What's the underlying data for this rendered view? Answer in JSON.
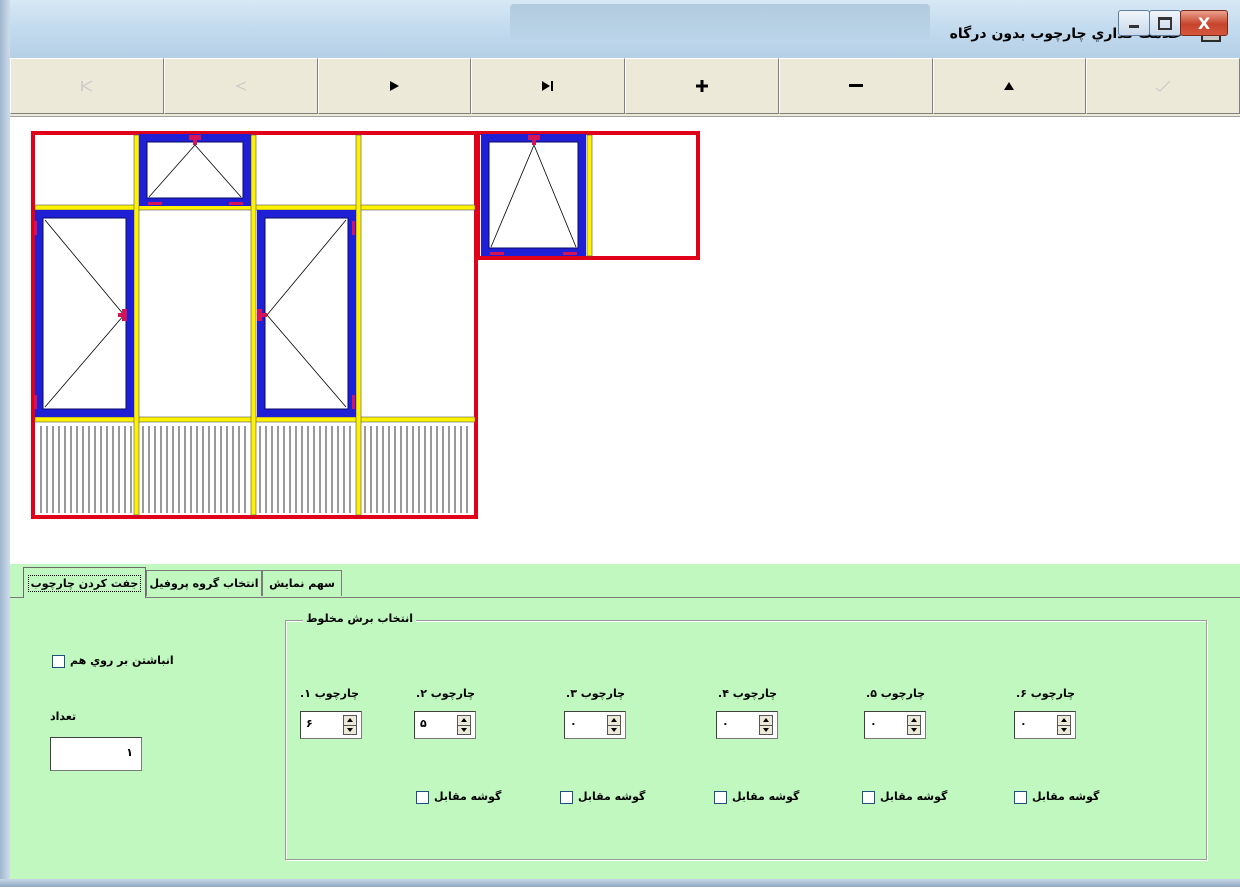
{
  "window": {
    "title": "علامت گذاري چارچوب بدون درگاه",
    "minimize_label": "",
    "maximize_label": "",
    "close_label": "X"
  },
  "toolbar": {
    "buttons": [
      {
        "icon": "first-record-icon",
        "enabled": false
      },
      {
        "icon": "prev-record-icon",
        "enabled": false
      },
      {
        "icon": "next-record-icon",
        "enabled": true
      },
      {
        "icon": "last-record-icon",
        "enabled": true
      },
      {
        "icon": "add-icon",
        "enabled": true
      },
      {
        "icon": "remove-icon",
        "enabled": true
      },
      {
        "icon": "up-icon",
        "enabled": true
      },
      {
        "icon": "confirm-icon",
        "enabled": false
      }
    ]
  },
  "colors": {
    "frame": "#e0001a",
    "mullion": "#fff200",
    "sash": "#1f1fd6",
    "hardware": "#d4145a",
    "panel_bg": "#c0f8c0"
  },
  "tabs": [
    {
      "label": "جفت کردن چارچوب",
      "active": true
    },
    {
      "label": "انتخاب گروه پروفيل",
      "active": false
    },
    {
      "label": "سهم نمايش",
      "active": false
    }
  ],
  "panel": {
    "stack_checkbox_label": "انباشتن بر روي هم",
    "count_label": "تعداد",
    "count_value": "۱",
    "group_title": "انتخاب برش مخلوط",
    "frames": [
      {
        "label": "چارچوب ۱.",
        "value": "۶",
        "corner_label": ""
      },
      {
        "label": "چارچوب ۲.",
        "value": "۵",
        "corner_label": "گوشه مقابل"
      },
      {
        "label": "چارچوب ۳.",
        "value": "۰",
        "corner_label": "گوشه مقابل"
      },
      {
        "label": "چارچوب ۴.",
        "value": "۰",
        "corner_label": "گوشه مقابل"
      },
      {
        "label": "چارچوب ۵.",
        "value": "۰",
        "corner_label": "گوشه مقابل"
      },
      {
        "label": "چارچوب ۶.",
        "value": "۰",
        "corner_label": "گوشه مقابل"
      }
    ]
  }
}
